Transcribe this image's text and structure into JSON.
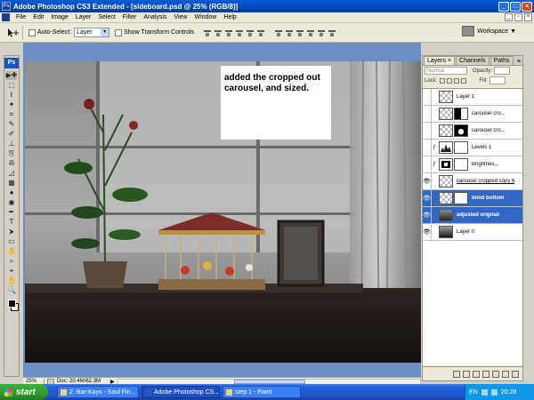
{
  "window": {
    "title": "Adobe Photoshop CS3 Extended - [sideboard.psd @ 25% (RGB/8)]",
    "app_icon": "Ps"
  },
  "menubar": {
    "items": [
      "File",
      "Edit",
      "Image",
      "Layer",
      "Select",
      "Filter",
      "Analysis",
      "View",
      "Window",
      "Help"
    ]
  },
  "options": {
    "auto_select_label": "Auto-Select:",
    "auto_select_value": "Layer",
    "transform_label": "Show Transform Controls",
    "workspace_label": "Workspace ▼"
  },
  "tools": {
    "badge": "Ps",
    "glyphs": [
      "▶✚",
      "⬚",
      "ℓ",
      "✦",
      "⌗",
      "✎",
      "✐",
      "⊥",
      "⎘",
      "✇",
      "◿",
      "▦",
      "●",
      "◉",
      "✒",
      "T",
      "⮞",
      "▭",
      "✋",
      "⌕",
      "⌖",
      "✋",
      "🔍"
    ]
  },
  "canvas": {
    "annotation": "added the cropped out carousel, and sized."
  },
  "status": {
    "zoom": "25%",
    "doc": "Doc: 20.4M/62.3M"
  },
  "layers_panel": {
    "tabs": [
      "Layers ×",
      "Channels",
      "Paths"
    ],
    "blend_mode": "Normal",
    "opacity_label": "Opacity:",
    "lock_label": "Lock:",
    "fill_label": "Fill:",
    "layers": [
      {
        "name": "Layer 1",
        "visible": false,
        "thumb": "checker",
        "mask": false,
        "selected": false
      },
      {
        "name": "carousel cro...",
        "visible": false,
        "thumb": "checker",
        "mask": "black-white",
        "selected": false
      },
      {
        "name": "carousel cro...",
        "visible": false,
        "thumb": "checker",
        "mask": "black-blob",
        "selected": false
      },
      {
        "name": "Levels 1",
        "visible": false,
        "thumb": "levels",
        "mask": "white",
        "selected": false
      },
      {
        "name": "Brightnes...",
        "visible": false,
        "thumb": "brightness",
        "mask": "white",
        "selected": false
      },
      {
        "name": "carousel cropped copy 6",
        "visible": true,
        "thumb": "checker",
        "mask": false,
        "selected": false
      },
      {
        "name": "blind bottom",
        "visible": true,
        "thumb": "checker",
        "mask": "white",
        "selected": true
      },
      {
        "name": "adjusted original",
        "visible": true,
        "thumb": "photo",
        "mask": false,
        "selected": true
      },
      {
        "name": "Layer 0",
        "visible": true,
        "thumb": "photo-dark",
        "mask": false,
        "selected": false
      }
    ]
  },
  "taskbar": {
    "start": "start",
    "tasks": [
      {
        "label": "2. Bar-Kays - Soul Fin...",
        "active": false
      },
      {
        "label": "Adobe Photoshop CS...",
        "active": true
      },
      {
        "label": "step 1 - Paint",
        "active": false
      }
    ],
    "lang": "EN",
    "clock": "20:28"
  },
  "colors": {
    "canvas_bg": "#6b8fc4",
    "selection_blue": "#3168c6",
    "taskbar_blue": "#245edb",
    "start_green": "#2e9b2e"
  }
}
